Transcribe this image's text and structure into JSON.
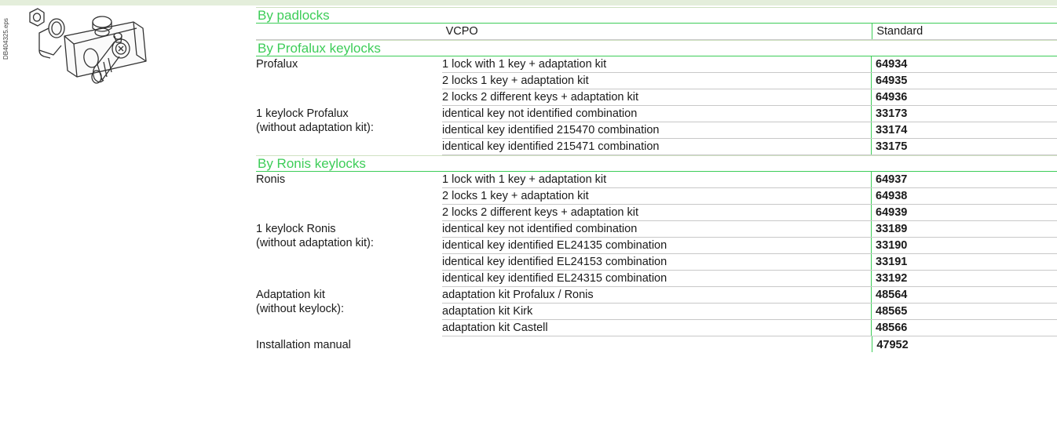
{
  "side_code": "DB404325.eps",
  "sections": {
    "padlocks": {
      "heading": "By padlocks",
      "row": {
        "description": "VCPO",
        "reference": "Standard"
      }
    },
    "profalux": {
      "heading": "By Profalux keylocks",
      "groups": [
        {
          "label": "Profalux",
          "rows": [
            {
              "description": "1 lock with 1 key + adaptation kit",
              "reference": "64934"
            },
            {
              "description": "2 locks 1 key + adaptation kit",
              "reference": "64935"
            },
            {
              "description": "2 locks 2 different keys + adaptation kit",
              "reference": "64936"
            }
          ]
        },
        {
          "label": "1 keylock Profalux\n(without adaptation kit):",
          "rows": [
            {
              "description": "identical key not identified combination",
              "reference": "33173"
            },
            {
              "description": "identical key identified 215470 combination",
              "reference": "33174"
            },
            {
              "description": "identical key identified 215471 combination",
              "reference": "33175"
            }
          ]
        }
      ]
    },
    "ronis": {
      "heading": "By Ronis keylocks",
      "groups": [
        {
          "label": "Ronis",
          "rows": [
            {
              "description": "1 lock with 1 key + adaptation kit",
              "reference": "64937"
            },
            {
              "description": "2 locks 1 key + adaptation kit",
              "reference": "64938"
            },
            {
              "description": "2 locks 2 different keys + adaptation kit",
              "reference": "64939"
            }
          ]
        },
        {
          "label": "1 keylock Ronis\n(without adaptation kit):",
          "rows": [
            {
              "description": "identical key not identified combination",
              "reference": "33189"
            },
            {
              "description": "identical key identified EL24135 combination",
              "reference": "33190"
            },
            {
              "description": "identical key identified EL24153 combination",
              "reference": "33191"
            },
            {
              "description": "identical key identified EL24315 combination",
              "reference": "33192"
            }
          ]
        },
        {
          "label": "Adaptation kit\n(without keylock):",
          "rows": [
            {
              "description": "adaptation kit Profalux / Ronis",
              "reference": "48564"
            },
            {
              "description": "adaptation kit Kirk",
              "reference": "48565"
            },
            {
              "description": "adaptation kit Castell",
              "reference": "48566"
            }
          ]
        }
      ]
    }
  },
  "manual": {
    "label": "Installation manual",
    "reference": "47952"
  },
  "colors": {
    "accent": "#3dcd58",
    "band": "#e4eedb",
    "rule": "#c8c8c8"
  },
  "icons": {
    "illustration": "keylock-assembly-illustration"
  }
}
